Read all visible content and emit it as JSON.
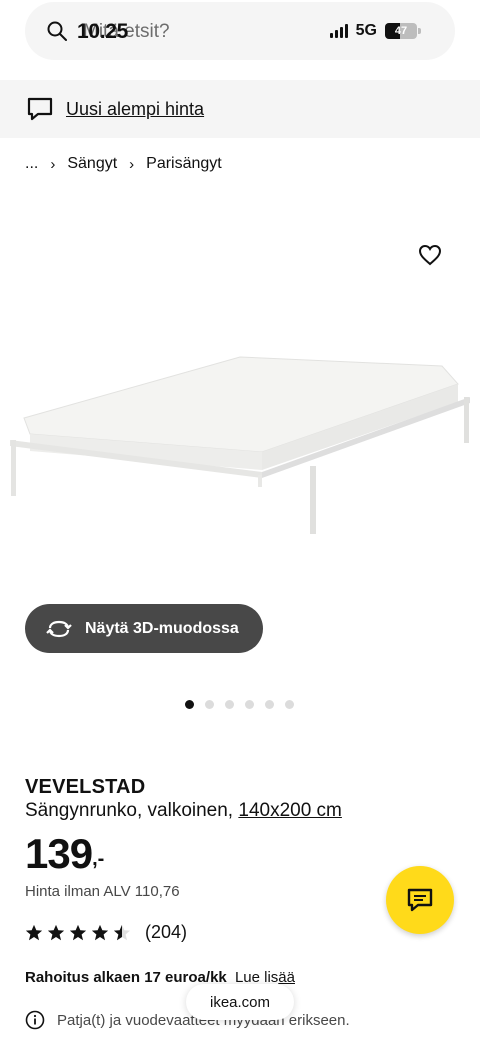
{
  "status_bar": {
    "time": "10.25",
    "network": "5G",
    "battery": "47",
    "battery_level": 0.47
  },
  "search": {
    "placeholder": "Mitä etsit?"
  },
  "banner": {
    "link_text": "Uusi alempi hinta",
    "icon": "chat-bubble-icon"
  },
  "breadcrumb": {
    "items": [
      "...",
      "Sängyt",
      "Parisängyt"
    ]
  },
  "gallery": {
    "view_3d_label": "Näytä 3D-muodossa",
    "image_count": 6,
    "active_index": 0
  },
  "product": {
    "name": "VEVELSTAD",
    "description": "Sängynrunko, valkoinen,",
    "size": "140x200 cm",
    "price": "139",
    "price_suffix": ",-",
    "vat_text": "Hinta ilman ALV 110,76",
    "rating": 4.5,
    "rating_count": "(204)"
  },
  "financing": {
    "text": "Rahoitus alkaen 17 euroa/kk",
    "more_prefix": "Lue lis",
    "more_underlined": "ää"
  },
  "info": {
    "text": "Patja(t) ja vuodevaatteet myydään erikseen."
  },
  "browser": {
    "url": "ikea.com"
  },
  "colors": {
    "accent": "#ffda1a",
    "pill_dark": "#484848",
    "banner_bg": "#f5f5f5"
  }
}
